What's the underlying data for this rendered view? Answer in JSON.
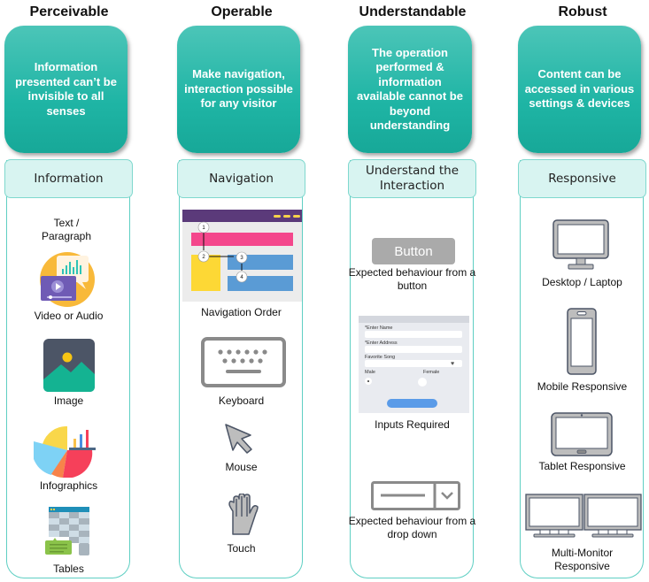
{
  "columns": [
    {
      "title": "Perceivable",
      "principle": "Information presented can’t be invisible to all senses",
      "subheader": "Information",
      "items": [
        {
          "label": "Text / Paragraph",
          "icon": "text-icon"
        },
        {
          "label": "Video or Audio",
          "icon": "video-audio-icon"
        },
        {
          "label": "Image",
          "icon": "image-icon"
        },
        {
          "label": "Infographics",
          "icon": "infographics-icon"
        },
        {
          "label": "Tables",
          "icon": "table-icon"
        }
      ]
    },
    {
      "title": "Operable",
      "principle": "Make navigation, interaction possible for any visitor",
      "subheader": "Navigation",
      "items": [
        {
          "label": "Navigation Order",
          "icon": "navigation-order-icon",
          "steps": [
            "1",
            "2",
            "3",
            "4"
          ]
        },
        {
          "label": "Keyboard",
          "icon": "keyboard-icon"
        },
        {
          "label": "Mouse",
          "icon": "mouse-cursor-icon"
        },
        {
          "label": "Touch",
          "icon": "hand-icon"
        }
      ]
    },
    {
      "title": "Understandable",
      "principle": "The operation performed & information available cannot be beyond understanding",
      "subheader": "Understand the Interaction",
      "items": [
        {
          "label": "Expected behaviour from a button",
          "icon": "button-icon",
          "button_text": "Button"
        },
        {
          "label": "Inputs Required",
          "icon": "form-icon",
          "form": {
            "name": "*Enter Name",
            "address": "*Enter Address",
            "song": "Favorite Song",
            "male": "Male",
            "female": "Female"
          }
        },
        {
          "label": "Expected behaviour from a drop down",
          "icon": "dropdown-icon"
        }
      ]
    },
    {
      "title": "Robust",
      "principle": "Content can be accessed in various settings & devices",
      "subheader": "Responsive",
      "items": [
        {
          "label": "Desktop / Laptop",
          "icon": "desktop-icon"
        },
        {
          "label": "Mobile Responsive",
          "icon": "mobile-icon"
        },
        {
          "label": "Tablet Responsive",
          "icon": "tablet-icon"
        },
        {
          "label": "Multi-Monitor Responsive",
          "icon": "multi-monitor-icon"
        }
      ]
    }
  ],
  "colors": {
    "teal": "#1fb5a5",
    "subheader_bg": "#d8f4f1",
    "panel_border": "#5fcfc3"
  }
}
